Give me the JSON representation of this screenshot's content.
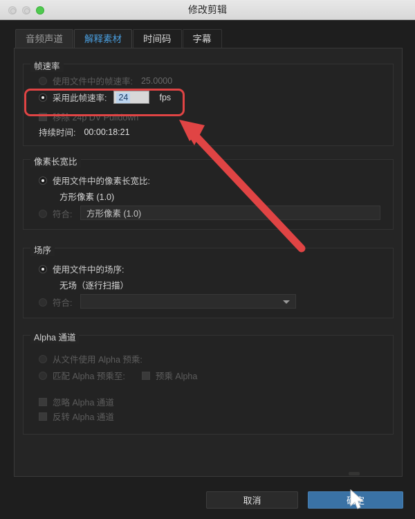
{
  "window": {
    "title": "修改剪辑",
    "traffic_lights": [
      "close",
      "minimize",
      "zoom"
    ]
  },
  "tabs": [
    {
      "label": "音频声道",
      "active": false
    },
    {
      "label": "解释素材",
      "active": true
    },
    {
      "label": "时间码",
      "active": false
    },
    {
      "label": "字幕",
      "active": false
    }
  ],
  "frame_rate": {
    "legend": "帧速率",
    "use_file_rate_label": "使用文件中的帧速率:",
    "use_file_rate_value": "25.0000",
    "assume_rate_label": "采用此帧速率:",
    "assume_rate_value": "24",
    "assume_rate_unit": "fps",
    "remove_pulldown_label": "移除 24p DV Pulldown",
    "duration_label": "持续时间:",
    "duration_value": "00:00:18:21"
  },
  "pixel_aspect": {
    "legend": "像素长宽比",
    "use_file_label": "使用文件中的像素长宽比:",
    "use_file_value": "方形像素 (1.0)",
    "conform_label": "符合:",
    "conform_value": "方形像素 (1.0)"
  },
  "field_order": {
    "legend": "场序",
    "use_file_label": "使用文件中的场序:",
    "use_file_value": "无场（逐行扫描）",
    "conform_label": "符合:",
    "conform_value": ""
  },
  "alpha_channel": {
    "legend": "Alpha 通道",
    "use_file_premultiply_label": "从文件使用 Alpha 预乘:",
    "match_premultiply_label": "匹配 Alpha 预乘至:",
    "premultiplied_alpha_label": "预乘 Alpha",
    "ignore_alpha_label": "忽略 Alpha 通道",
    "invert_alpha_label": "反转 Alpha 通道"
  },
  "buttons": {
    "cancel": "取消",
    "ok": "确定"
  },
  "annotations": {
    "highlight_color": "#e04444",
    "arrow_color": "#e04444"
  },
  "colors": {
    "accent_blue": "#4a9fe0",
    "ok_button": "#3a72a5",
    "panel_bg": "#252525",
    "window_bg": "#1e1e1e"
  }
}
